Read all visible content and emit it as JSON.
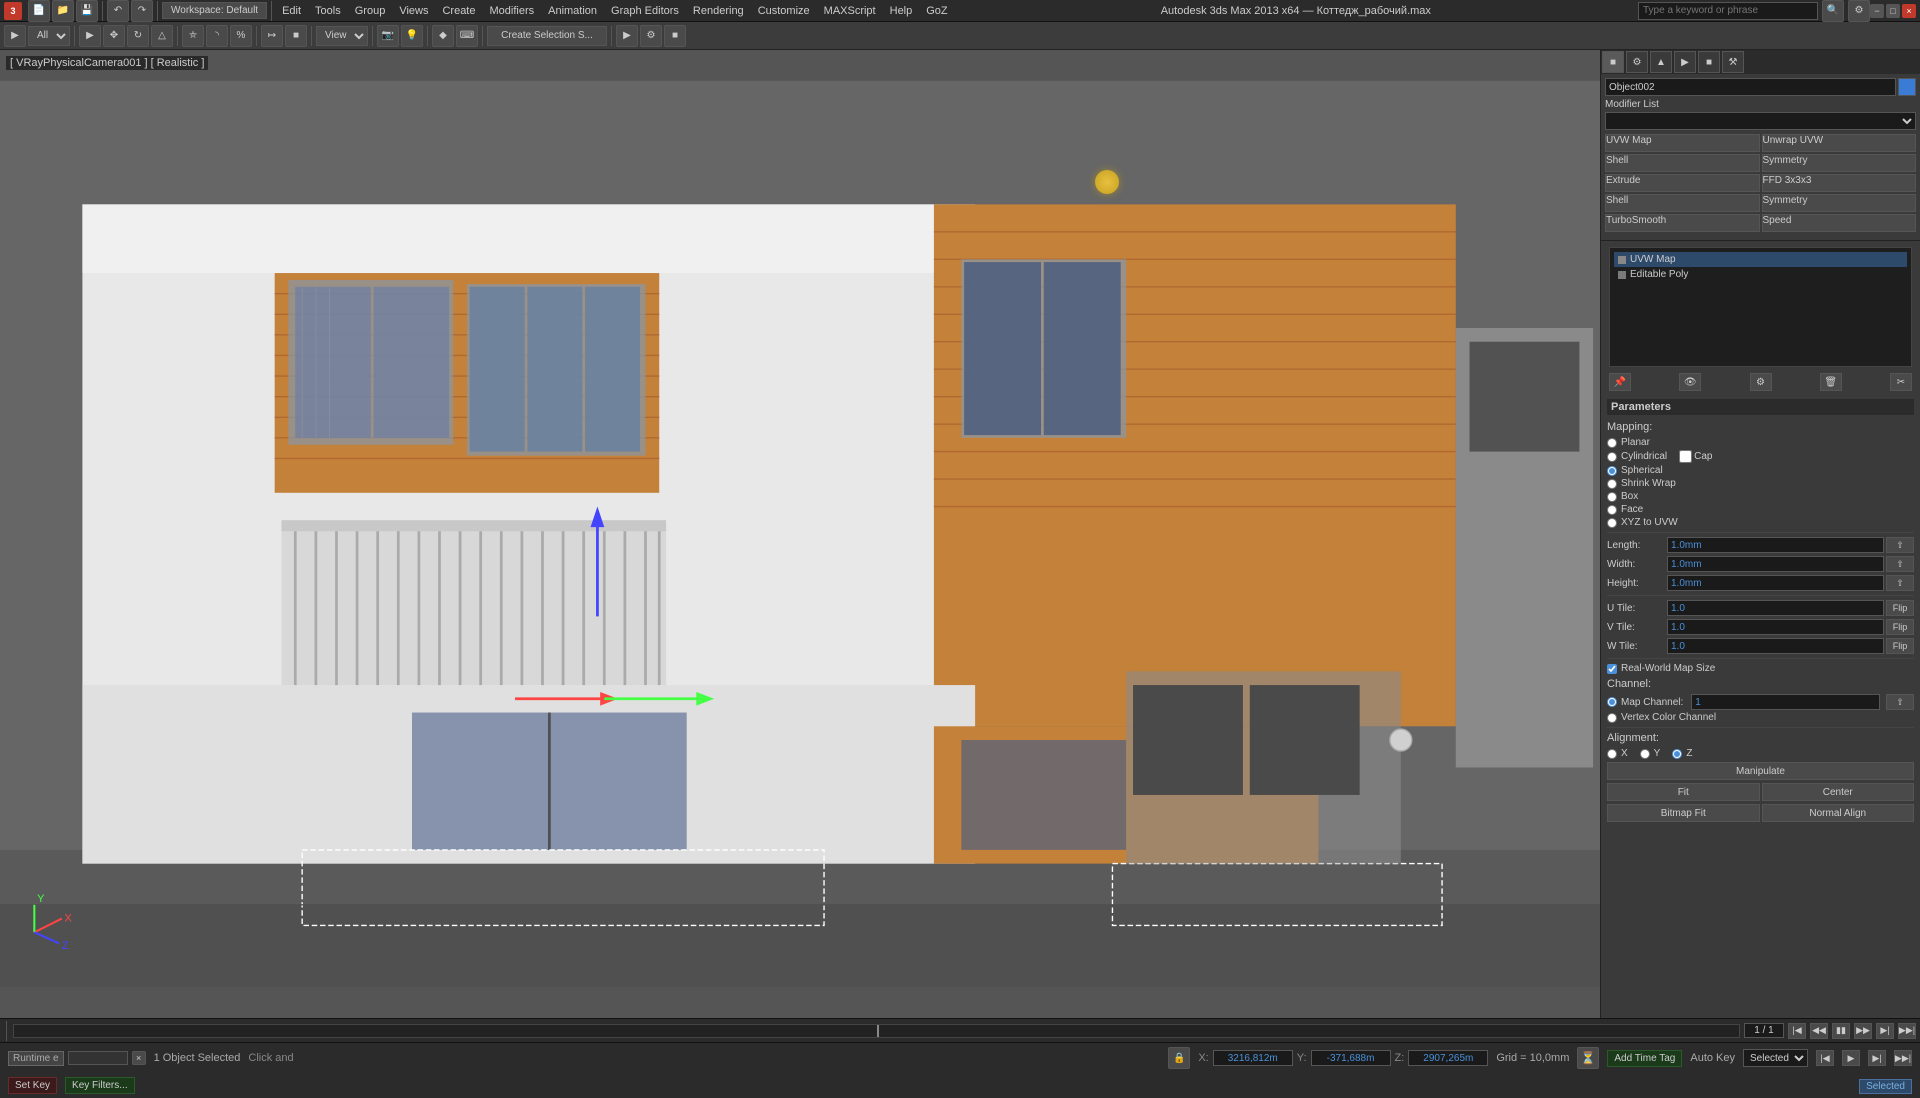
{
  "app": {
    "title": "Autodesk 3ds Max 2013 x64 — Коттедж_рабочий.max",
    "workspace": "Workspace: Default"
  },
  "menu": {
    "items": [
      "Edit",
      "Tools",
      "Group",
      "Views",
      "Create",
      "Modifiers",
      "Animation",
      "Graph Editors",
      "Rendering",
      "Customize",
      "MAXScript",
      "Help",
      "GoZ"
    ]
  },
  "search": {
    "placeholder": "Type a keyword or phrase"
  },
  "viewport": {
    "label": "[ VRayPhysicalCamera001 ] [ Realistic ]"
  },
  "right_panel": {
    "object_name": "Object002",
    "modifier_list_label": "Modifier List",
    "modifiers": [
      {
        "name": "UVW Map",
        "active": true
      },
      {
        "name": "Unwrap UVW",
        "active": false
      },
      {
        "name": "Shell",
        "active": true
      },
      {
        "name": "Symmetry",
        "active": false
      },
      {
        "name": "Extrude",
        "active": false
      },
      {
        "name": "FFD 3x3x3",
        "active": false
      },
      {
        "name": "Shell",
        "active": true
      },
      {
        "name": "Symmetry",
        "active": false
      },
      {
        "name": "TurboSmooth",
        "active": false
      },
      {
        "name": "Speed",
        "active": false
      }
    ],
    "stack": [
      {
        "name": "UVW Map",
        "selected": true
      },
      {
        "name": "Editable Poly",
        "selected": false
      }
    ],
    "parameters": {
      "title": "Parameters",
      "mapping_label": "Mapping:",
      "mapping_options": [
        "Planar",
        "Cylindrical",
        "Spherical",
        "Shrink Wrap",
        "Box",
        "Face",
        "XYZ to UVW"
      ],
      "selected_mapping": "Spherical",
      "length_label": "Length:",
      "length_val": "1.0mm",
      "width_label": "Width:",
      "width_val": "1.0mm",
      "height_label": "Height:",
      "height_val": "1.0mm",
      "u_tile_label": "U Tile:",
      "u_tile_val": "1.0",
      "v_tile_label": "V Tile:",
      "v_tile_val": "1.0",
      "w_tile_label": "W Tile:",
      "w_tile_val": "1.0",
      "flip_label": "Flip",
      "real_world_label": "Real-World Map Size",
      "channel_label": "Channel:",
      "map_channel_label": "Map Channel:",
      "map_channel_val": "1",
      "vertex_color_label": "Vertex Color Channel",
      "alignment_label": "Alignment:",
      "align_x_label": "X",
      "align_y_label": "Y",
      "align_z_label": "Z",
      "manipulate_btn": "Manipulate",
      "fit_btn": "Fit",
      "center_btn": "Center",
      "bitmap_fit_btn": "Bitmap Fit",
      "normal_align_btn": "Normal Align"
    }
  },
  "status_bar": {
    "selected_text": "1 Object Selected",
    "click_text": "Click and",
    "x_label": "X:",
    "x_val": "3216,812m",
    "y_label": "Y:",
    "y_val": "-371,688m",
    "z_label": "Z:",
    "z_val": "2907,265m",
    "grid_label": "Grid = 10,0mm",
    "time_tag_btn": "Add Time Tag",
    "auto_key_label": "Auto Key",
    "selected_mode": "Selected",
    "key_filters_label": "Key Filters...",
    "set_key_label": "Set Key"
  },
  "timeline": {
    "frame_display": "1 / 1"
  },
  "runtime": "Runtime e"
}
